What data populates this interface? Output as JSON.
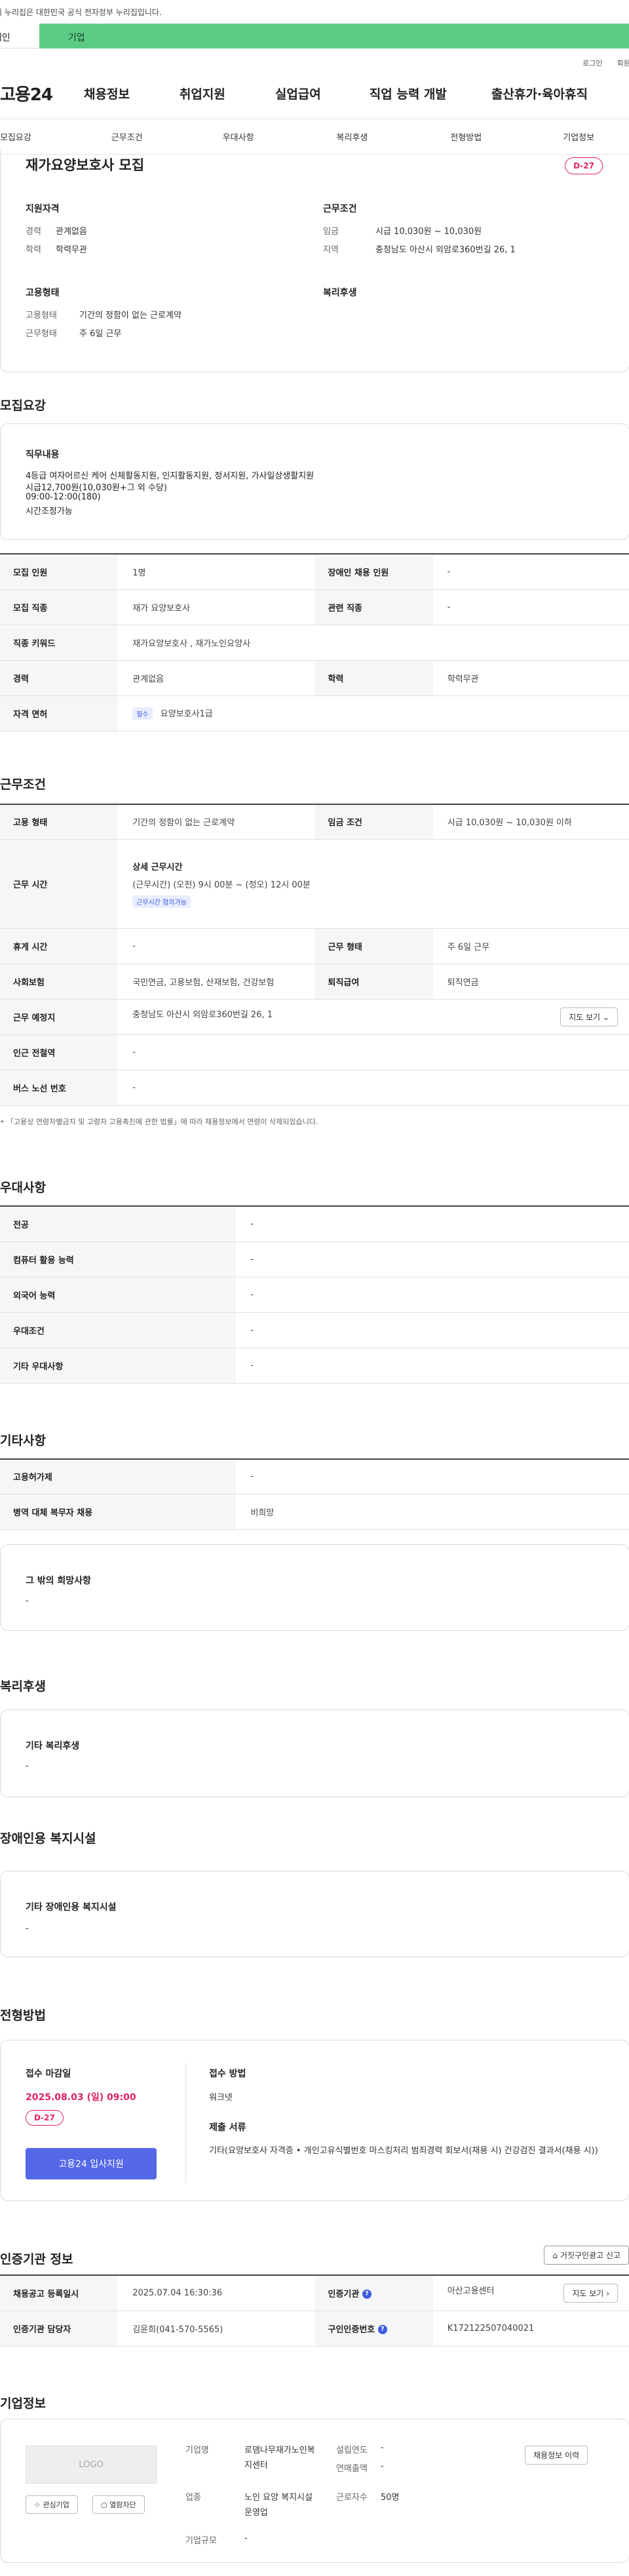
{
  "gov_notice": "이 누리집은 대한민국 공식 전자정부 누리집입니다.",
  "user_tabs": {
    "personal": "개인",
    "company": "기업"
  },
  "util": {
    "login": "로그인",
    "join": "회원가입"
  },
  "logo": "고용24",
  "gnb": [
    "채용정보",
    "취업지원",
    "실업급여",
    "직업 능력 개발",
    "출산휴가·육아휴직"
  ],
  "subnav": [
    "모집요강",
    "근무조건",
    "우대사항",
    "복리후생",
    "전형방법",
    "기업정보"
  ],
  "summary": {
    "title": "재가요양보호사 모집",
    "dday": "D-27",
    "qual_heading": "지원자격",
    "exp_label": "경력",
    "exp_value": "관계없음",
    "edu_label": "학력",
    "edu_value": "학력무관",
    "cond_heading": "근무조건",
    "wage_label": "임금",
    "wage_value": "시급 10,030원 ~ 10,030원",
    "region_label": "지역",
    "region_value": "충청남도 아산시 외암로360번길 26, 1",
    "emp_heading": "고용형태",
    "emp_type_label": "고용형태",
    "emp_type_value": "기간의 정함이 없는 근로계약",
    "work_type_label": "근무형태",
    "work_type_value": "주 6일 근무",
    "welfare_heading": "복리후생"
  },
  "recruit": {
    "heading": "모집요강",
    "duty_heading": "직무내용",
    "duty_lines": [
      "4등급 여자어르신 케어 신체활동지원, 인지활동지원, 정서지원, 가사일상생활지원",
      "시급12,700원(10,030원+그 외 수당)",
      "09:00-12:00(180)",
      "시간조정가능"
    ],
    "people_label": "모집 인원",
    "people_value": "1명",
    "disabled_label": "장애인 채용 인원",
    "disabled_value": "-",
    "job_label": "모집 직종",
    "job_value": "재가 요양보호사",
    "related_label": "관련 직종",
    "related_value": "-",
    "keyword_label": "직종 키워드",
    "keyword_value": "재가요양보호사 , 재가노인요양사",
    "exp_label": "경력",
    "exp_value": "관계없음",
    "edu_label": "학력",
    "edu_value": "학력무관",
    "license_label": "자격 면허",
    "license_badge": "필수",
    "license_value": "요양보호사1급"
  },
  "conditions": {
    "heading": "근무조건",
    "emp_label": "고용 형태",
    "emp_value": "기간의 정함이 없는 근로계약",
    "wage_label": "임금 조건",
    "wage_value": "시급 10,030원 ~ 10,030원 이하",
    "time_label": "근무 시간",
    "time_title": "상세 근무시간",
    "time_value": "(근무시간) (오전) 9시 00분 ~ (정오) 12시 00분",
    "time_badge": "근무시간 협의가능",
    "rest_label": "휴게 시간",
    "rest_value": "-",
    "worktype_label": "근무 형태",
    "worktype_value": "주 6일 근무",
    "ins_label": "사회보험",
    "ins_value": "국민연금, 고용보험, 산재보험, 건강보험",
    "retire_label": "퇴직급여",
    "retire_value": "퇴직연금",
    "place_label": "근무 예정지",
    "place_value": "충청남도 아산시 외암로360번길 26, 1",
    "map_btn": "지도 보기",
    "station_label": "인근 전철역",
    "station_value": "-",
    "bus_label": "버스 노선 번호",
    "bus_value": "-",
    "note": "「고용상 연령차별금지 및 고령자 고용촉진에 관한 법률」에 따라 채용정보에서 연령이 삭제되었습니다."
  },
  "pref": {
    "heading": "우대사항",
    "rows": [
      {
        "label": "전공",
        "value": "-"
      },
      {
        "label": "컴퓨터 활용 능력",
        "value": "-"
      },
      {
        "label": "외국어 능력",
        "value": "-"
      },
      {
        "label": "우대조건",
        "value": "-"
      },
      {
        "label": "기타 우대사항",
        "value": "-"
      }
    ]
  },
  "etc": {
    "heading": "기타사항",
    "rows": [
      {
        "label": "고용허가제",
        "value": "-"
      },
      {
        "label": "병역 대체 복무자 채용",
        "value": "비희망"
      }
    ],
    "other_heading": "그 밖의 희망사항",
    "other_value": "-"
  },
  "welfare": {
    "heading": "복리후생",
    "sub": "기타 복리후생",
    "value": "-"
  },
  "disabled": {
    "heading": "장애인용 복지시설",
    "sub": "기타 장애인용 복지시설",
    "value": "-"
  },
  "selection": {
    "heading": "전형방법",
    "deadline_label": "접수 마감일",
    "deadline_value": "2025.08.03 (일) 09:00",
    "dday": "D-27",
    "apply_btn": "고용24 입사지원",
    "method_label": "접수 방법",
    "method_value": "워크넷",
    "docs_label": "제출 서류",
    "docs_value": "기타(요양보호사 자격증 • 개인고유식별번호 마스킹처리 범죄경력 회보서(채용 시) 건강검진 결과서(채용 시))"
  },
  "agency": {
    "heading": "인증기관 정보",
    "report_btn": "거짓구인광고 신고",
    "reg_label": "채용공고 등록일시",
    "reg_value": "2025.07.04 16:30:36",
    "org_label": "인증기관",
    "org_value": "아산고용센터",
    "map_btn": "지도 보기",
    "manager_label": "인증기관 담당자",
    "manager_value": "김윤희(041-570-5565)",
    "no_label": "구인인증번호",
    "no_value": "K172122507040021"
  },
  "company": {
    "heading": "기업정보",
    "logo": "LOGO",
    "fav_btn": "관심기업",
    "block_btn": "열람차단",
    "name_label": "기업명",
    "name_value": "로뎀나무재가노인복지센터",
    "year_label": "설립연도",
    "year_value": "-",
    "sales_label": "연매출액",
    "sales_value": "-",
    "industry_label": "업종",
    "industry_value": "노인 요양 복지시설 운영업",
    "emp_label": "근로자수",
    "emp_value": "50명",
    "size_label": "기업규모",
    "size_value": "-",
    "history_btn": "채용정보 이력"
  }
}
